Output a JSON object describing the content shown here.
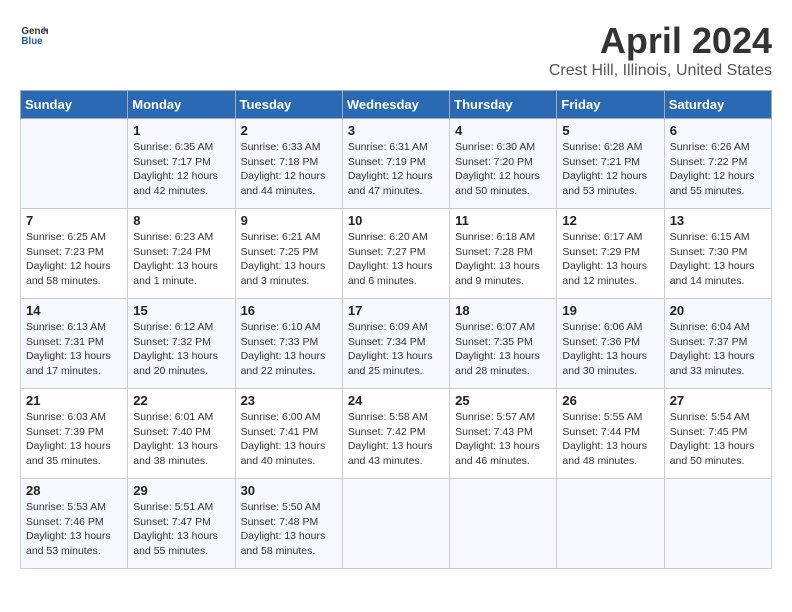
{
  "logo": {
    "general": "General",
    "blue": "Blue"
  },
  "title": "April 2024",
  "subtitle": "Crest Hill, Illinois, United States",
  "columns": [
    "Sunday",
    "Monday",
    "Tuesday",
    "Wednesday",
    "Thursday",
    "Friday",
    "Saturday"
  ],
  "weeks": [
    [
      {
        "day": "",
        "sunrise": "",
        "sunset": "",
        "daylight": ""
      },
      {
        "day": "1",
        "sunrise": "Sunrise: 6:35 AM",
        "sunset": "Sunset: 7:17 PM",
        "daylight": "Daylight: 12 hours and 42 minutes."
      },
      {
        "day": "2",
        "sunrise": "Sunrise: 6:33 AM",
        "sunset": "Sunset: 7:18 PM",
        "daylight": "Daylight: 12 hours and 44 minutes."
      },
      {
        "day": "3",
        "sunrise": "Sunrise: 6:31 AM",
        "sunset": "Sunset: 7:19 PM",
        "daylight": "Daylight: 12 hours and 47 minutes."
      },
      {
        "day": "4",
        "sunrise": "Sunrise: 6:30 AM",
        "sunset": "Sunset: 7:20 PM",
        "daylight": "Daylight: 12 hours and 50 minutes."
      },
      {
        "day": "5",
        "sunrise": "Sunrise: 6:28 AM",
        "sunset": "Sunset: 7:21 PM",
        "daylight": "Daylight: 12 hours and 53 minutes."
      },
      {
        "day": "6",
        "sunrise": "Sunrise: 6:26 AM",
        "sunset": "Sunset: 7:22 PM",
        "daylight": "Daylight: 12 hours and 55 minutes."
      }
    ],
    [
      {
        "day": "7",
        "sunrise": "Sunrise: 6:25 AM",
        "sunset": "Sunset: 7:23 PM",
        "daylight": "Daylight: 12 hours and 58 minutes."
      },
      {
        "day": "8",
        "sunrise": "Sunrise: 6:23 AM",
        "sunset": "Sunset: 7:24 PM",
        "daylight": "Daylight: 13 hours and 1 minute."
      },
      {
        "day": "9",
        "sunrise": "Sunrise: 6:21 AM",
        "sunset": "Sunset: 7:25 PM",
        "daylight": "Daylight: 13 hours and 3 minutes."
      },
      {
        "day": "10",
        "sunrise": "Sunrise: 6:20 AM",
        "sunset": "Sunset: 7:27 PM",
        "daylight": "Daylight: 13 hours and 6 minutes."
      },
      {
        "day": "11",
        "sunrise": "Sunrise: 6:18 AM",
        "sunset": "Sunset: 7:28 PM",
        "daylight": "Daylight: 13 hours and 9 minutes."
      },
      {
        "day": "12",
        "sunrise": "Sunrise: 6:17 AM",
        "sunset": "Sunset: 7:29 PM",
        "daylight": "Daylight: 13 hours and 12 minutes."
      },
      {
        "day": "13",
        "sunrise": "Sunrise: 6:15 AM",
        "sunset": "Sunset: 7:30 PM",
        "daylight": "Daylight: 13 hours and 14 minutes."
      }
    ],
    [
      {
        "day": "14",
        "sunrise": "Sunrise: 6:13 AM",
        "sunset": "Sunset: 7:31 PM",
        "daylight": "Daylight: 13 hours and 17 minutes."
      },
      {
        "day": "15",
        "sunrise": "Sunrise: 6:12 AM",
        "sunset": "Sunset: 7:32 PM",
        "daylight": "Daylight: 13 hours and 20 minutes."
      },
      {
        "day": "16",
        "sunrise": "Sunrise: 6:10 AM",
        "sunset": "Sunset: 7:33 PM",
        "daylight": "Daylight: 13 hours and 22 minutes."
      },
      {
        "day": "17",
        "sunrise": "Sunrise: 6:09 AM",
        "sunset": "Sunset: 7:34 PM",
        "daylight": "Daylight: 13 hours and 25 minutes."
      },
      {
        "day": "18",
        "sunrise": "Sunrise: 6:07 AM",
        "sunset": "Sunset: 7:35 PM",
        "daylight": "Daylight: 13 hours and 28 minutes."
      },
      {
        "day": "19",
        "sunrise": "Sunrise: 6:06 AM",
        "sunset": "Sunset: 7:36 PM",
        "daylight": "Daylight: 13 hours and 30 minutes."
      },
      {
        "day": "20",
        "sunrise": "Sunrise: 6:04 AM",
        "sunset": "Sunset: 7:37 PM",
        "daylight": "Daylight: 13 hours and 33 minutes."
      }
    ],
    [
      {
        "day": "21",
        "sunrise": "Sunrise: 6:03 AM",
        "sunset": "Sunset: 7:39 PM",
        "daylight": "Daylight: 13 hours and 35 minutes."
      },
      {
        "day": "22",
        "sunrise": "Sunrise: 6:01 AM",
        "sunset": "Sunset: 7:40 PM",
        "daylight": "Daylight: 13 hours and 38 minutes."
      },
      {
        "day": "23",
        "sunrise": "Sunrise: 6:00 AM",
        "sunset": "Sunset: 7:41 PM",
        "daylight": "Daylight: 13 hours and 40 minutes."
      },
      {
        "day": "24",
        "sunrise": "Sunrise: 5:58 AM",
        "sunset": "Sunset: 7:42 PM",
        "daylight": "Daylight: 13 hours and 43 minutes."
      },
      {
        "day": "25",
        "sunrise": "Sunrise: 5:57 AM",
        "sunset": "Sunset: 7:43 PM",
        "daylight": "Daylight: 13 hours and 46 minutes."
      },
      {
        "day": "26",
        "sunrise": "Sunrise: 5:55 AM",
        "sunset": "Sunset: 7:44 PM",
        "daylight": "Daylight: 13 hours and 48 minutes."
      },
      {
        "day": "27",
        "sunrise": "Sunrise: 5:54 AM",
        "sunset": "Sunset: 7:45 PM",
        "daylight": "Daylight: 13 hours and 50 minutes."
      }
    ],
    [
      {
        "day": "28",
        "sunrise": "Sunrise: 5:53 AM",
        "sunset": "Sunset: 7:46 PM",
        "daylight": "Daylight: 13 hours and 53 minutes."
      },
      {
        "day": "29",
        "sunrise": "Sunrise: 5:51 AM",
        "sunset": "Sunset: 7:47 PM",
        "daylight": "Daylight: 13 hours and 55 minutes."
      },
      {
        "day": "30",
        "sunrise": "Sunrise: 5:50 AM",
        "sunset": "Sunset: 7:48 PM",
        "daylight": "Daylight: 13 hours and 58 minutes."
      },
      {
        "day": "",
        "sunrise": "",
        "sunset": "",
        "daylight": ""
      },
      {
        "day": "",
        "sunrise": "",
        "sunset": "",
        "daylight": ""
      },
      {
        "day": "",
        "sunrise": "",
        "sunset": "",
        "daylight": ""
      },
      {
        "day": "",
        "sunrise": "",
        "sunset": "",
        "daylight": ""
      }
    ]
  ]
}
